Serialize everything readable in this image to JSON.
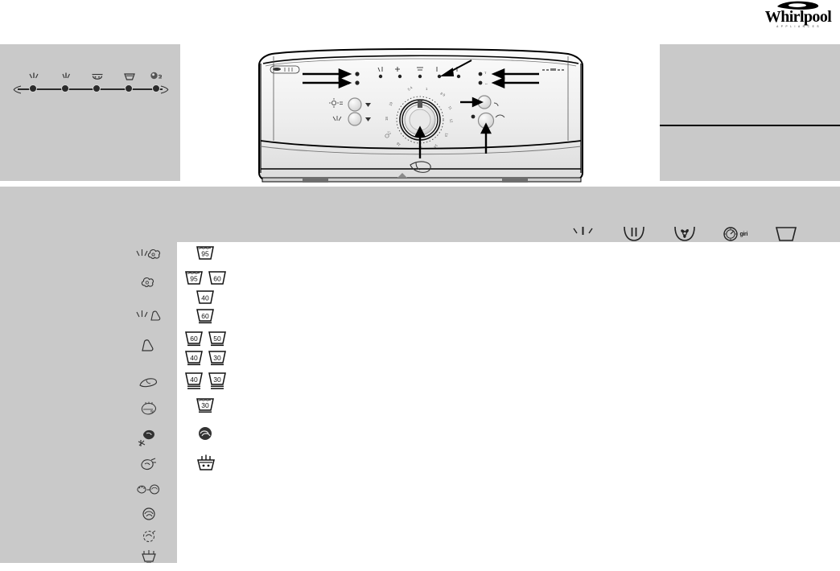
{
  "brand": {
    "name": "Whirlpool",
    "tagline": "A P P L I A N C E S",
    "logo_icon": "whirlpool-swoosh-icon"
  },
  "top_left_panel": {
    "name": "cycle-progress-timeline",
    "background_color": "#c9c9c9",
    "nodes": [
      {
        "index": 1,
        "icon": "prewash-icon",
        "label": ""
      },
      {
        "index": 2,
        "icon": "mainwash-icon",
        "label": ""
      },
      {
        "index": 3,
        "icon": "rinse-icon",
        "label": ""
      },
      {
        "index": 4,
        "icon": "spin-tub-icon",
        "label": ""
      },
      {
        "index": 5,
        "icon": "end-of-cycle-icon",
        "label": ""
      }
    ]
  },
  "machine": {
    "name": "washing-machine-control-panel-illustration",
    "body_color": "#f2f2f2",
    "outline_color": "#000000",
    "knob": {
      "name": "program-selector-knob",
      "pointer_marker": "triangle-marker"
    },
    "left_buttons": [
      {
        "name": "temperature-button",
        "icon": "temperature-icon"
      },
      {
        "name": "spin-speed-button",
        "icon": "spin-speed-icon"
      }
    ],
    "right_buttons": [
      {
        "name": "start-button",
        "icon": "start-icon"
      },
      {
        "name": "on-off-button",
        "icon": "power-icon"
      }
    ],
    "indicator_rows": [
      {
        "name": "option-indicator-row-top"
      },
      {
        "name": "option-indicator-row-bottom"
      }
    ],
    "callout_arrows": 6
  },
  "top_right_panel": {
    "name": "notes-panel",
    "background_color": "#c9c9c9",
    "divider_color": "#000000"
  },
  "lower_panel": {
    "name": "program-chart",
    "background_color": "#c9c9c9",
    "table_background_color": "#ffffff"
  },
  "column_headers": [
    {
      "name": "prewash-column-header",
      "icon": "prewash-tub-icon",
      "caption": ""
    },
    {
      "name": "mainwash-column-header",
      "icon": "mainwash-tub-icon",
      "caption": ""
    },
    {
      "name": "spin-column-header",
      "icon": "spin-tub-icon",
      "caption": ""
    },
    {
      "name": "spin-speed-column-header",
      "icon": "spin-speed-dial-icon",
      "caption": "giri"
    },
    {
      "name": "water-level-column-header",
      "icon": "empty-tub-icon",
      "caption": ""
    }
  ],
  "rows": [
    {
      "fabric_icon": "cotton-prewash-icon",
      "care_labels": [
        "95"
      ]
    },
    {
      "fabric_icon": "cotton-icon",
      "care_labels": [
        "95",
        "60",
        "40"
      ]
    },
    {
      "fabric_icon": "synthetics-prewash-icon",
      "care_labels": [
        "60"
      ]
    },
    {
      "fabric_icon": "synthetics-icon",
      "care_labels": [
        "60",
        "50",
        "40",
        "30"
      ]
    },
    {
      "fabric_icon": "delicates-icon",
      "care_labels": [
        "40",
        "30"
      ]
    },
    {
      "fabric_icon": "wool-icon",
      "care_labels": [
        "30"
      ]
    },
    {
      "fabric_icon": "handwash-icon",
      "care_labels": [
        "handwash-symbol"
      ]
    },
    {
      "fabric_icon": "rinse-icon",
      "care_labels": [
        "rinse-tub-symbol"
      ]
    },
    {
      "fabric_icon": "softener-icon",
      "care_labels": []
    },
    {
      "fabric_icon": "drain-icon",
      "care_labels": []
    },
    {
      "fabric_icon": "gentle-spin-icon",
      "care_labels": []
    },
    {
      "fabric_icon": "spin-icon",
      "care_labels": []
    }
  ],
  "care_label_values": {
    "v95": "95",
    "v60": "60",
    "v50": "50",
    "v40": "40",
    "v30": "30"
  }
}
